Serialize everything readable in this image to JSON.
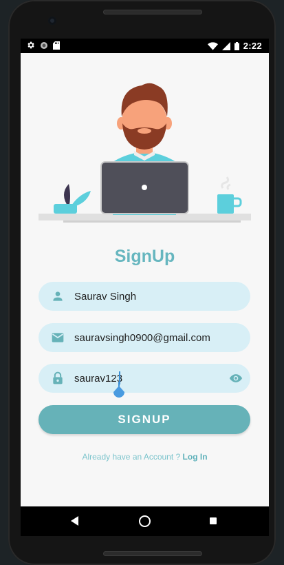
{
  "status_bar": {
    "time": "2:22"
  },
  "screen": {
    "title": "SignUp"
  },
  "form": {
    "name_value": "Saurav Singh",
    "email_value": "sauravsingh0900@gmail.com",
    "password_value": "saurav123"
  },
  "signup_button": {
    "label": "SIGNUP"
  },
  "login": {
    "prompt": "Already have an Account ?",
    "link": "Log In"
  },
  "colors": {
    "accent": "#66b6bf",
    "button": "#66b2b8",
    "field_bg": "#d8eff6"
  },
  "icons": [
    "settings-icon",
    "record-icon",
    "sd-card-icon",
    "wifi-icon",
    "signal-icon",
    "battery-icon",
    "person-icon",
    "email-icon",
    "lock-icon",
    "eye-icon",
    "back-icon",
    "home-icon",
    "recents-icon"
  ]
}
